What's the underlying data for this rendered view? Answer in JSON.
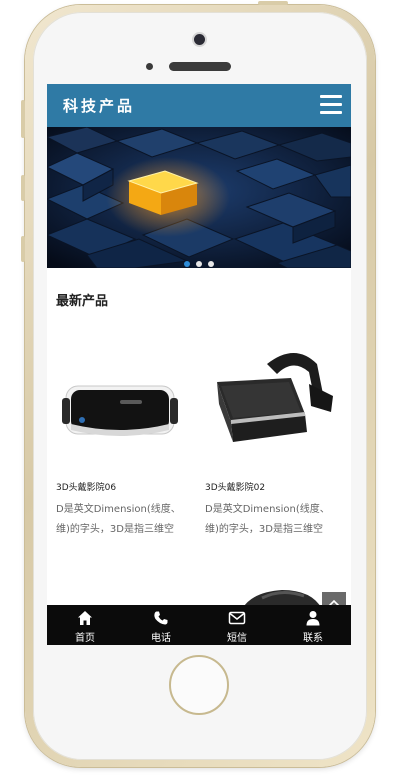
{
  "header": {
    "title": "科技产品",
    "menu_icon": "hamburger-menu-icon",
    "background": "#2f7aa5"
  },
  "banner": {
    "slide_count": 3,
    "active_slide": 1,
    "accent": "#f2b416",
    "dot_active_color": "#2d8cd8"
  },
  "section": {
    "title": "最新产品"
  },
  "products": [
    {
      "name": "3D头戴影院06",
      "desc": "D是英文Dimension(线度、维)的字头，3D是指三维空"
    },
    {
      "name": "3D头戴影院02",
      "desc": "D是英文Dimension(线度、维)的字头，3D是指三维空"
    }
  ],
  "nav": [
    {
      "label": "首页",
      "icon": "home-icon"
    },
    {
      "label": "电话",
      "icon": "phone-icon"
    },
    {
      "label": "短信",
      "icon": "envelope-icon"
    },
    {
      "label": "联系",
      "icon": "user-icon"
    }
  ]
}
